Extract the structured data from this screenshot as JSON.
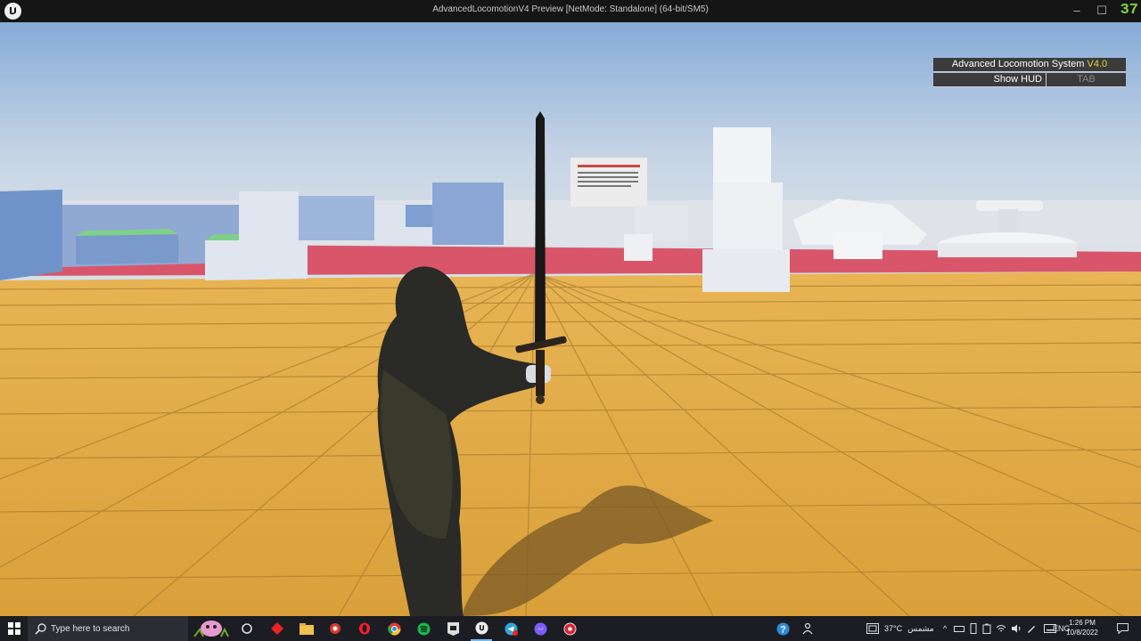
{
  "window": {
    "title": "AdvancedLocomotionV4 Preview [NetMode: Standalone]  (64-bit/SM5)",
    "fps": "37",
    "controls": [
      "–",
      "☐",
      "✕"
    ]
  },
  "hud": {
    "title": "Advanced Locomotion System",
    "version": "V4.0",
    "show_hud_label": "Show HUD",
    "show_hud_key": "TAB"
  },
  "taskbar": {
    "search_placeholder": "Type here to search",
    "weather": "37°C",
    "weather_label": "مشمس",
    "language": "ENG",
    "time": "1:26 PM",
    "date": "10/8/2022",
    "colors": {
      "accent": "#1db954",
      "taskbar": "#1b1d22"
    }
  }
}
